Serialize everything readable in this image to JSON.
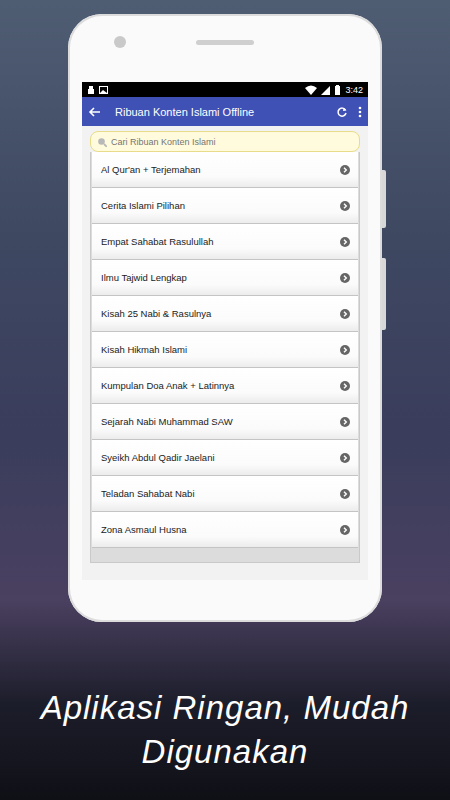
{
  "status_bar": {
    "time": "3:42"
  },
  "app_bar": {
    "title": "Ribuan Konten Islami Offline"
  },
  "search": {
    "placeholder": "Cari Ribuan Konten Islami"
  },
  "list": {
    "items": [
      "Al Qur'an + Terjemahan",
      "Cerita Islami Pilihan",
      "Empat Sahabat Rasulullah",
      "Ilmu Tajwid Lengkap",
      "Kisah 25 Nabi & Rasulnya",
      "Kisah Hikmah Islami",
      "Kumpulan Doa Anak + Latinnya",
      "Sejarah Nabi Muhammad SAW",
      "Syeikh Abdul Qadir Jaelani",
      "Teladan Sahabat Nabi",
      "Zona Asmaul Husna"
    ]
  },
  "caption": {
    "lines": [
      "Aplikasi Ringan, Mudah",
      "Digunakan"
    ]
  }
}
